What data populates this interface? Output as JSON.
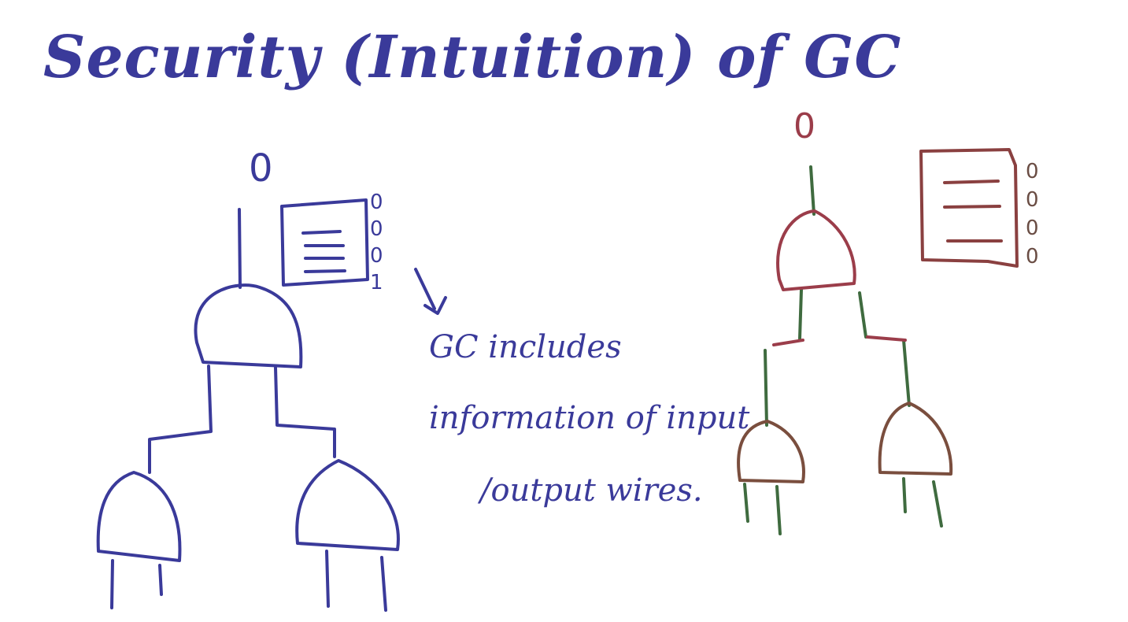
{
  "title": "Security (Intuition) of GC",
  "left_diagram": {
    "output_bit": "0",
    "table_bits": [
      "0",
      "0",
      "0",
      "1"
    ],
    "note_lines": [
      "GC includes",
      "information of input",
      "/output wires."
    ],
    "color": "#3a3a9a"
  },
  "right_diagram": {
    "output_bit": "0",
    "table_bits": [
      "0",
      "0",
      "0",
      "0"
    ],
    "colors": {
      "wire": "#3f6b3f",
      "gate": "#9b3d4a"
    }
  }
}
